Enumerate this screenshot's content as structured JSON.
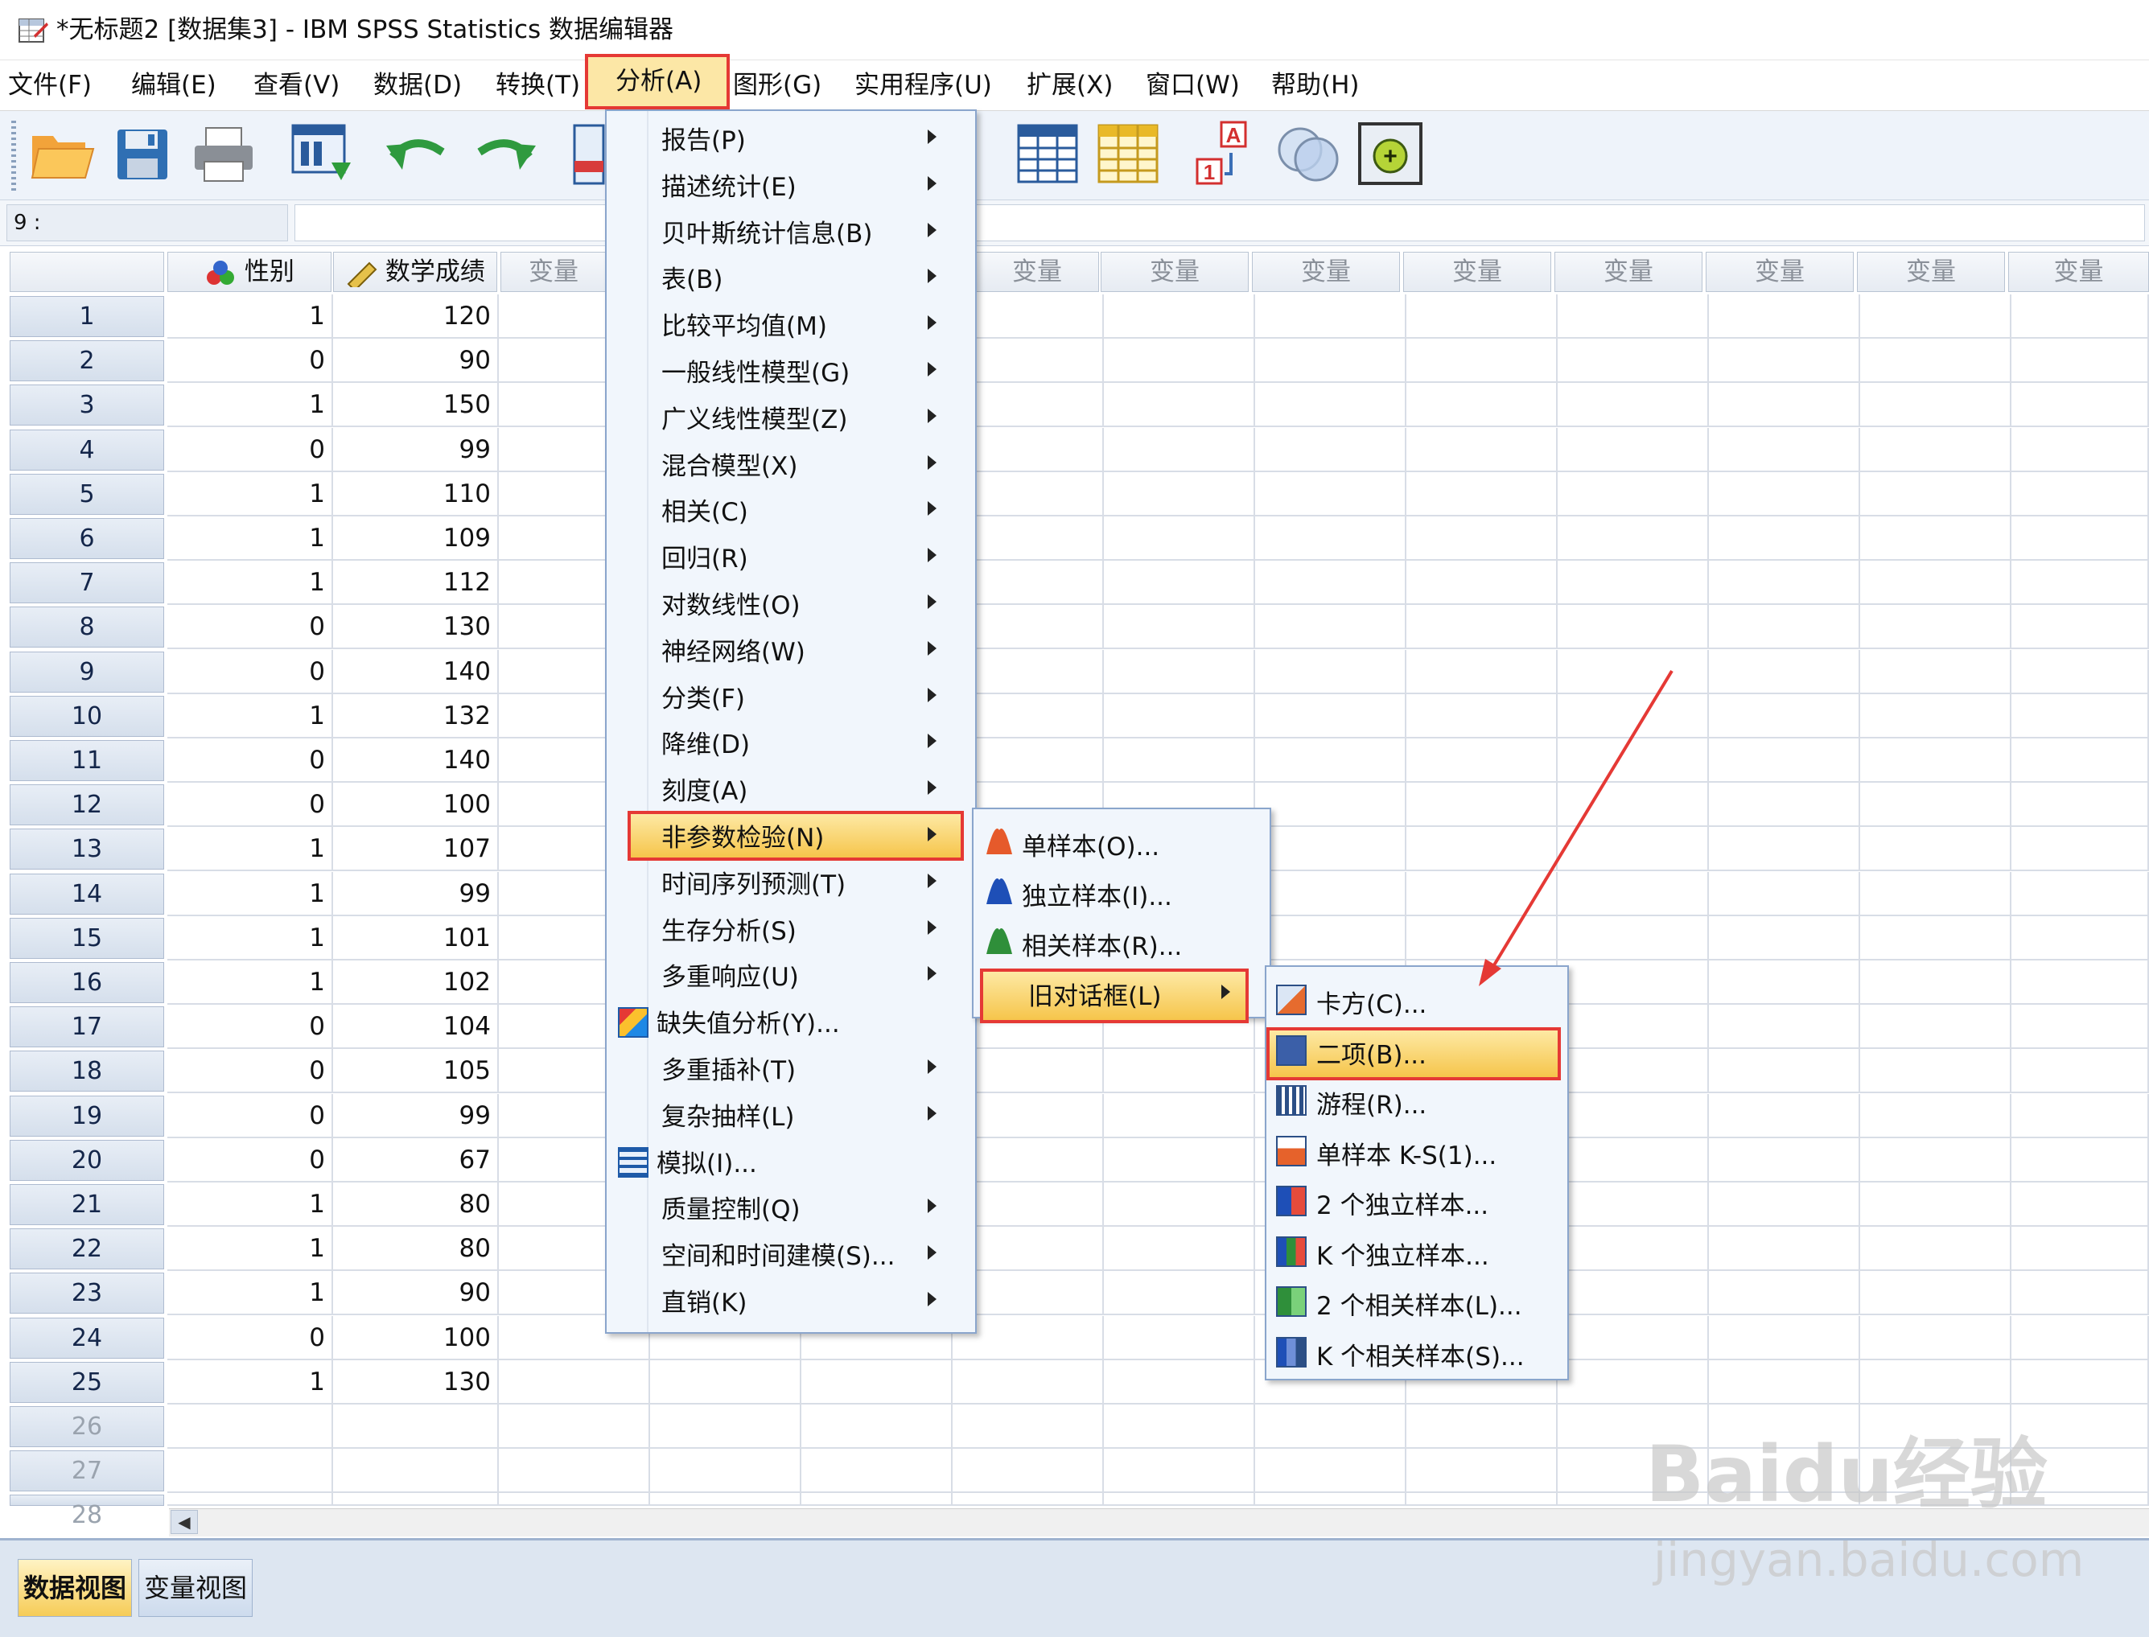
{
  "window": {
    "title": "*无标题2 [数据集3] - IBM SPSS Statistics 数据编辑器"
  },
  "menubar": [
    {
      "label": "文件(F)"
    },
    {
      "label": "编辑(E)"
    },
    {
      "label": "查看(V)"
    },
    {
      "label": "数据(D)"
    },
    {
      "label": "转换(T)"
    },
    {
      "label": "分析(A)"
    },
    {
      "label": "图形(G)"
    },
    {
      "label": "实用程序(U)"
    },
    {
      "label": "扩展(X)"
    },
    {
      "label": "窗口(W)"
    },
    {
      "label": "帮助(H)"
    }
  ],
  "cellbar": {
    "cell_ref": "9 :"
  },
  "grid": {
    "columns": [
      "性别",
      "数学成绩",
      "变量",
      "变量",
      "变量",
      "变量",
      "变量",
      "变量",
      "变量",
      "变量",
      "变量",
      "变量",
      "变量"
    ],
    "row_numbers": [
      "1",
      "2",
      "3",
      "4",
      "5",
      "6",
      "7",
      "8",
      "9",
      "10",
      "11",
      "12",
      "13",
      "14",
      "15",
      "16",
      "17",
      "18",
      "19",
      "20",
      "21",
      "22",
      "23",
      "24",
      "25",
      "26",
      "27",
      "28"
    ],
    "gender": [
      "1",
      "0",
      "1",
      "0",
      "1",
      "1",
      "1",
      "0",
      "0",
      "1",
      "0",
      "0",
      "1",
      "1",
      "1",
      "1",
      "0",
      "0",
      "0",
      "0",
      "1",
      "1",
      "1",
      "0",
      "1"
    ],
    "math": [
      "120",
      "90",
      "150",
      "99",
      "110",
      "109",
      "112",
      "130",
      "140",
      "132",
      "140",
      "100",
      "107",
      "99",
      "101",
      "102",
      "104",
      "105",
      "99",
      "67",
      "80",
      "80",
      "90",
      "100",
      "130"
    ]
  },
  "analyze_menu": [
    {
      "label": "报告(P)",
      "submenu": true
    },
    {
      "label": "描述统计(E)",
      "submenu": true
    },
    {
      "label": "贝叶斯统计信息(B)",
      "submenu": true
    },
    {
      "label": "表(B)",
      "submenu": true
    },
    {
      "label": "比较平均值(M)",
      "submenu": true
    },
    {
      "label": "一般线性模型(G)",
      "submenu": true
    },
    {
      "label": "广义线性模型(Z)",
      "submenu": true
    },
    {
      "label": "混合模型(X)",
      "submenu": true
    },
    {
      "label": "相关(C)",
      "submenu": true
    },
    {
      "label": "回归(R)",
      "submenu": true
    },
    {
      "label": "对数线性(O)",
      "submenu": true
    },
    {
      "label": "神经网络(W)",
      "submenu": true
    },
    {
      "label": "分类(F)",
      "submenu": true
    },
    {
      "label": "降维(D)",
      "submenu": true
    },
    {
      "label": "刻度(A)",
      "submenu": true
    },
    {
      "label": "非参数检验(N)",
      "submenu": true,
      "selected": true
    },
    {
      "label": "时间序列预测(T)",
      "submenu": true
    },
    {
      "label": "生存分析(S)",
      "submenu": true
    },
    {
      "label": "多重响应(U)",
      "submenu": true
    },
    {
      "label": "缺失值分析(Y)...",
      "submenu": false,
      "icon": "missing-value-icon"
    },
    {
      "label": "多重插补(T)",
      "submenu": true
    },
    {
      "label": "复杂抽样(L)",
      "submenu": true
    },
    {
      "label": "模拟(I)...",
      "submenu": false,
      "icon": "simulation-icon"
    },
    {
      "label": "质量控制(Q)",
      "submenu": true
    },
    {
      "label": "空间和时间建模(S)...",
      "submenu": true
    },
    {
      "label": "直销(K)",
      "submenu": true
    }
  ],
  "nonparam_menu": [
    {
      "label": "单样本(O)...",
      "icon": "one-sample-icon"
    },
    {
      "label": "独立样本(I)...",
      "icon": "independent-samples-icon"
    },
    {
      "label": "相关样本(R)...",
      "icon": "related-samples-icon"
    },
    {
      "label": "旧对话框(L)",
      "submenu": true,
      "selected": true
    }
  ],
  "legacy_menu": [
    {
      "label": "卡方(C)...",
      "icon": "chi-square-icon"
    },
    {
      "label": "二项(B)...",
      "icon": "binomial-icon",
      "selected": true
    },
    {
      "label": "游程(R)...",
      "icon": "runs-icon"
    },
    {
      "label": "单样本 K-S(1)...",
      "icon": "ks-icon"
    },
    {
      "label": "2 个独立样本...",
      "icon": "two-independent-icon"
    },
    {
      "label": "K 个独立样本...",
      "icon": "k-independent-icon"
    },
    {
      "label": "2 个相关样本(L)...",
      "icon": "two-related-icon"
    },
    {
      "label": "K 个相关样本(S)...",
      "icon": "k-related-icon"
    }
  ],
  "tabs": [
    {
      "label": "数据视图",
      "active": true
    },
    {
      "label": "变量视图",
      "active": false
    }
  ],
  "watermark": {
    "logo": "Baidu经验",
    "site": "jingyan.baidu.com"
  },
  "colors": {
    "highlight_border": "#e53935",
    "menu_bg": "#f1f6fc",
    "selection": "#f6c54b"
  }
}
